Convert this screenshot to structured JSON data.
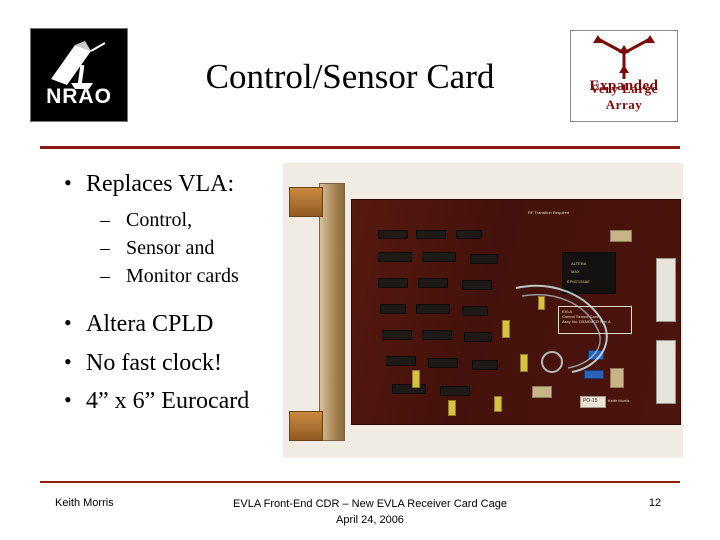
{
  "slide": {
    "title": "Control/Sensor Card",
    "page_number": "12"
  },
  "logos": {
    "nrao": {
      "text": "NRAO",
      "icon": "radio-telescope-dish"
    },
    "evla": {
      "line1": "Expanded",
      "line2": "Very Large Array",
      "icon": "y-array-antennas"
    }
  },
  "bullets": [
    {
      "level": 1,
      "marker": "•",
      "text": "Replaces VLA:"
    },
    {
      "level": 2,
      "marker": "–",
      "text": "Control,"
    },
    {
      "level": 2,
      "marker": "–",
      "text": "Sensor and"
    },
    {
      "level": 2,
      "marker": "–",
      "text": "Monitor cards"
    },
    {
      "level": 1,
      "marker": "•",
      "text": "Altera CPLD"
    },
    {
      "level": 1,
      "marker": "•",
      "text": "No fast clock!"
    },
    {
      "level": 1,
      "marker": "•",
      "text": "4” x 6” Eurocard"
    }
  ],
  "photo": {
    "alt": "Photograph of the EVLA Control/Sensor Card printed circuit board",
    "silkscreen": {
      "top_note": "RF Transition Required",
      "chip_label_1": "ALTERA",
      "chip_label_2": "MAX",
      "chip_label_3": "EPM7128AE",
      "board_title_1": "EVLA",
      "board_title_2": "Control Sensor Card",
      "board_title_3": "Assy No. D53804CD Rev A",
      "designer": "Keith Morris",
      "tag": "PO-15"
    }
  },
  "footer": {
    "author": "Keith Morris",
    "event_line1": "EVLA Front-End CDR – New EVLA Receiver Card Cage",
    "event_line2": "April 24, 2006"
  },
  "colors": {
    "rule": "#8b1a11",
    "evla_text": "#7b0a0a",
    "pcb": "#46120c"
  }
}
